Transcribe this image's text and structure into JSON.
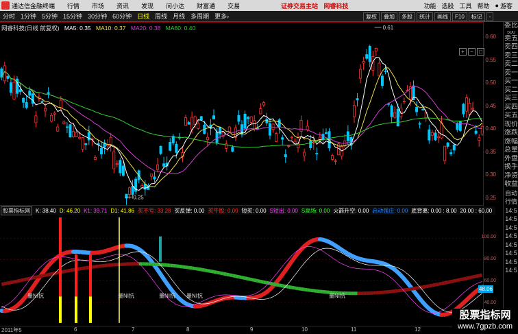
{
  "menu": {
    "app_title": "通达信金融终端",
    "items": [
      "行情",
      "市场",
      "资讯",
      "发现",
      "问小达",
      "财富通",
      "交易"
    ],
    "promo": [
      "证券交易主站",
      "网睿科技"
    ],
    "right_items": [
      "功能",
      "选股",
      "工具",
      "帮助"
    ],
    "guest": "游客"
  },
  "toolbar": {
    "periods": [
      "分时",
      "1分钟",
      "5分钟",
      "15分钟",
      "30分钟",
      "60分钟",
      "日线",
      "周线",
      "月线",
      "多周期",
      "更多"
    ],
    "active": "日线",
    "more_suffix": "›",
    "right_buttons": [
      "复权",
      "叠加",
      "多股",
      "统计",
      "画线",
      "F10",
      "标记",
      "-"
    ]
  },
  "main_chart": {
    "title": "网睿科技(日线 前复权)",
    "ma": [
      {
        "label": "MA5: 0.35",
        "color": "#ffffff"
      },
      {
        "label": "MA10: 0.37",
        "color": "#f0e050"
      },
      {
        "label": "MA20: 0.38",
        "color": "#d040d0"
      },
      {
        "label": "MA60: 0.40",
        "color": "#30d030"
      }
    ],
    "y_ticks": [
      "0.60",
      "0.55",
      "0.50",
      "0.45",
      "0.40",
      "0.35",
      "0.30",
      "0.25"
    ],
    "high_label": "0.61",
    "low_label": "0.25",
    "up_color": "#ff3333",
    "down_color": "#00c8ff"
  },
  "sub_chart": {
    "name": "股票指标网",
    "values": [
      {
        "label": "K: 38.40",
        "color": "#ffffff"
      },
      {
        "label": "D: 46.20",
        "color": "#ffff00"
      },
      {
        "label": "K1: 39.71",
        "color": "#ff40ff"
      },
      {
        "label": "D1: 41.86",
        "color": "#ffff00"
      },
      {
        "label": "买不亏: 33.28",
        "color": "#ff3030"
      },
      {
        "label": "买反弹: 0.00",
        "color": "#ffffff"
      },
      {
        "label": "买牛股: 0.00",
        "color": "#ff3030"
      },
      {
        "label": "短买: 0.00",
        "color": "#ffffff"
      },
      {
        "label": "S短出: 0.00",
        "color": "#ff40ff"
      },
      {
        "label": "S高场: 0.00",
        "color": "#30ff30"
      },
      {
        "label": "火箭升空: 0.00",
        "color": "#ffffff"
      },
      {
        "label": "启动强庄: 0.00",
        "color": "#2080ff"
      },
      {
        "label": "底背离: 0.00 : 8.00",
        "color": "#ffffff"
      },
      {
        "label": "20.00 : 60.00",
        "color": "#ffffff"
      }
    ],
    "y_ticks": [
      "100.00",
      "80.00",
      "60.00",
      "40.00",
      "20.00"
    ],
    "signal_label": "量NI抗",
    "current_tag": "48.06"
  },
  "time_axis": [
    "2011年5",
    "6",
    "7",
    "8",
    "9",
    "10",
    "11",
    "12"
  ],
  "sidebar": [
    "委比",
    "卖五",
    "卖四",
    "卖三",
    "卖二",
    "卖一",
    "买一",
    "买二",
    "买三",
    "买四",
    "买五",
    "现价",
    "涨跌",
    "涨幅",
    "总量",
    "外盘",
    "换手",
    "净资",
    "收益",
    "自动",
    "行情",
    "14:5",
    "14:5",
    "14:5",
    "14:5",
    "14:5",
    "14:5",
    "14:5",
    "14:5"
  ],
  "sidebar_row1": "500",
  "watermark": {
    "line1": "股票指标网",
    "line2": "www.7gpzb.com"
  }
}
